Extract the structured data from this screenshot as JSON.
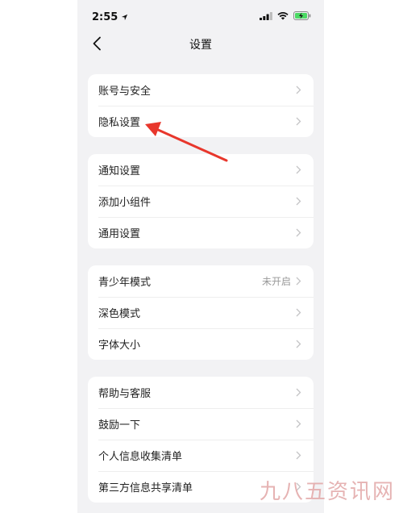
{
  "status_bar": {
    "time": "2:55",
    "icons": [
      "location-arrow-icon",
      "signal-icon",
      "wifi-icon",
      "battery-charging-icon"
    ]
  },
  "nav": {
    "title": "设置",
    "back_icon": "chevron-left-icon"
  },
  "groups": [
    {
      "items": [
        {
          "label": "账号与安全"
        },
        {
          "label": "隐私设置"
        }
      ]
    },
    {
      "items": [
        {
          "label": "通知设置"
        },
        {
          "label": "添加小组件"
        },
        {
          "label": "通用设置"
        }
      ]
    },
    {
      "items": [
        {
          "label": "青少年模式",
          "value": "未开启"
        },
        {
          "label": "深色模式"
        },
        {
          "label": "字体大小"
        }
      ]
    },
    {
      "items": [
        {
          "label": "帮助与客服"
        },
        {
          "label": "鼓励一下"
        },
        {
          "label": "个人信息收集清单"
        },
        {
          "label": "第三方信息共享清单"
        }
      ]
    }
  ],
  "annotation": {
    "icon": "red-arrow-icon",
    "color": "#e8372c"
  },
  "watermark": {
    "text": "九八五资讯网"
  },
  "colors": {
    "background": "#f2f2f4",
    "card": "#ffffff",
    "chevron": "#c4c4c6"
  }
}
